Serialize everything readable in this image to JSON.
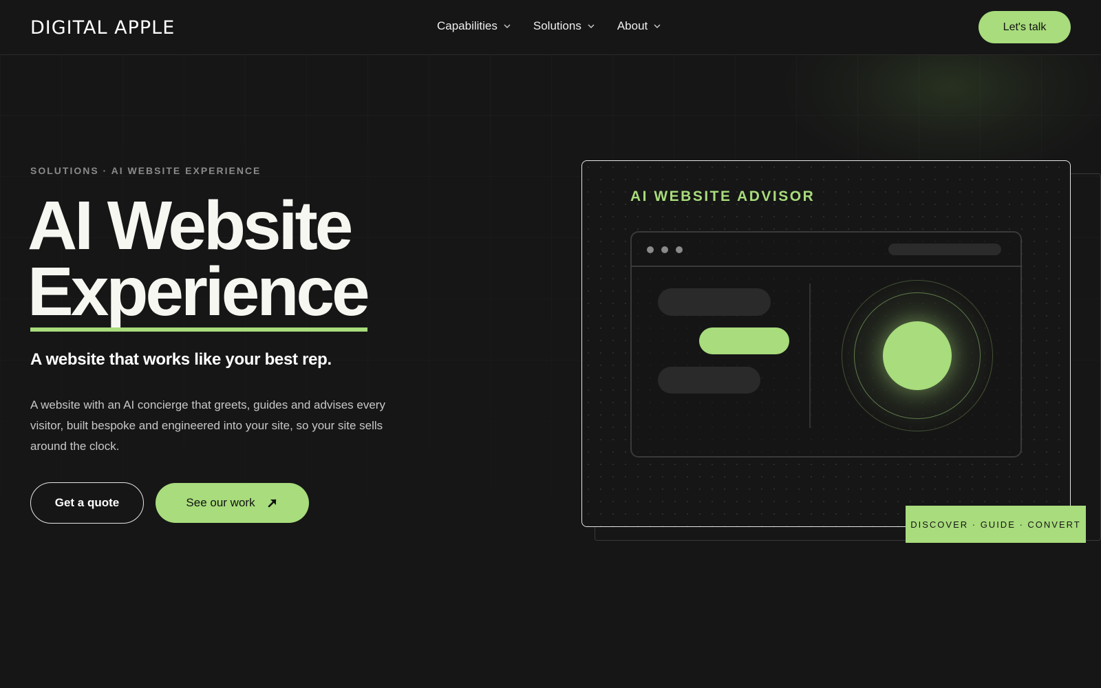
{
  "header": {
    "logo_text": "DIGITAL APPLE",
    "nav": [
      {
        "label": "Capabilities",
        "icon": "chevron-down-icon"
      },
      {
        "label": "Solutions",
        "icon": "chevron-down-icon"
      },
      {
        "label": "About",
        "icon": "chevron-down-icon"
      }
    ],
    "cta_label": "Let's talk"
  },
  "hero": {
    "eyebrow": "SOLUTIONS · AI WEBSITE EXPERIENCE",
    "title_line1": "AI Website",
    "title_line2": "Experience",
    "subtitle": "A website that works like your best rep.",
    "description": "A website with an AI concierge that greets, guides and advises every visitor, built bespoke and engineered into your site, so your site sells around the clock.",
    "primary_button": "Get a quote",
    "secondary_button": "See our work",
    "secondary_icon": "arrow-up-right-icon"
  },
  "card": {
    "title": "AI WEBSITE ADVISOR",
    "tagline": "DISCOVER · GUIDE · CONVERT"
  },
  "colors": {
    "background": "#161616",
    "accent": "#a8dc7c",
    "text": "#f2f2f2",
    "muted": "#8a8a8a"
  }
}
